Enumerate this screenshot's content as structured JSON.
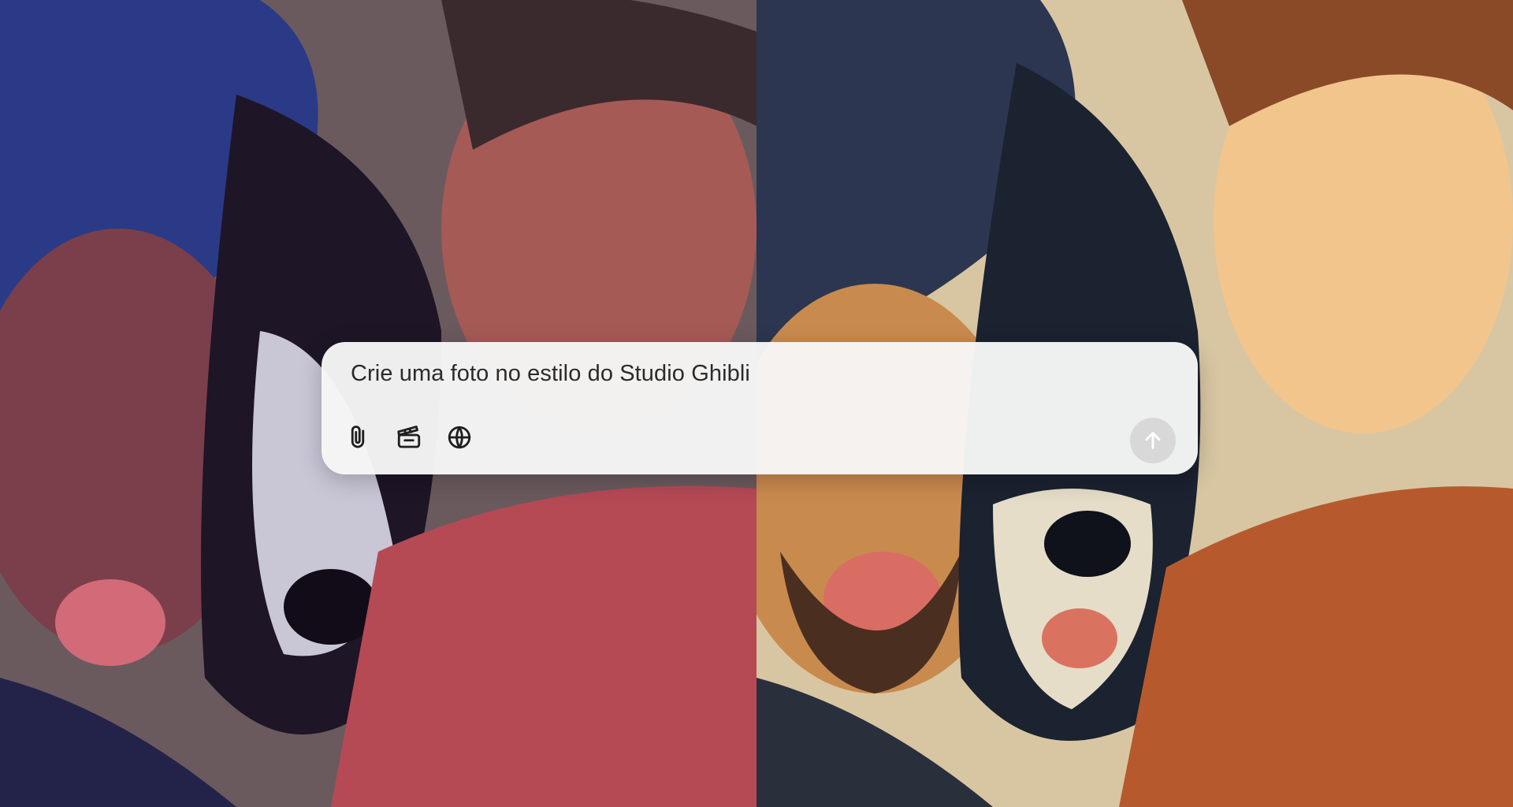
{
  "composer": {
    "prompt_text": "Crie uma foto no estilo do Studio Ghibli",
    "tools": [
      {
        "icon": "paperclip-icon"
      },
      {
        "icon": "clapperboard-icon"
      },
      {
        "icon": "globe-icon"
      }
    ],
    "send_icon": "arrow-up-icon"
  },
  "colors": {
    "composer_bg": "#f6f6f6",
    "text": "#2b2b2b",
    "icon": "#1f1f1f",
    "send_button_bg": "#d8d8d8"
  }
}
